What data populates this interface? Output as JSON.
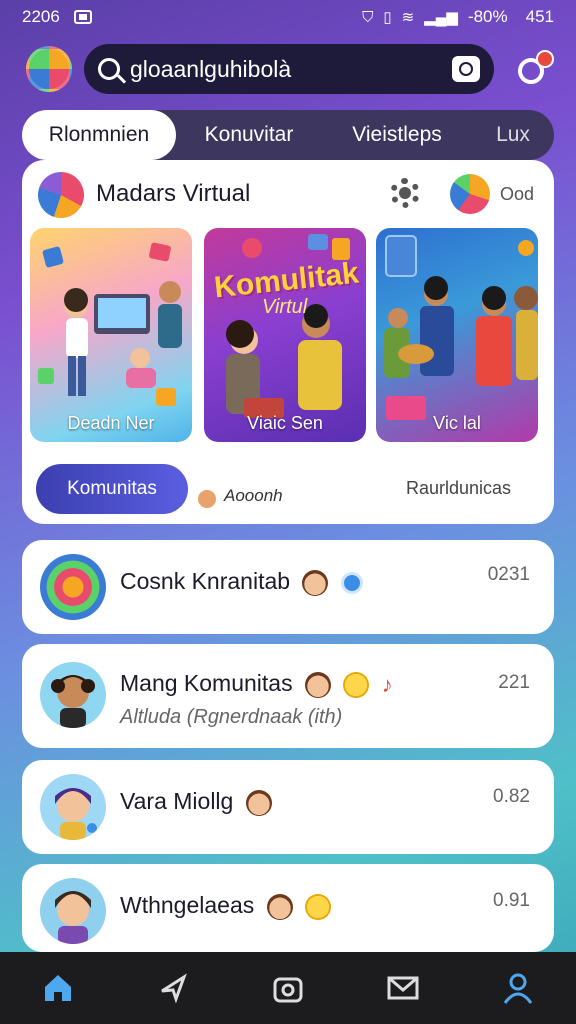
{
  "status_bar": {
    "time": "2206",
    "battery": "-80%",
    "clock": "451"
  },
  "header": {
    "search_value": "gloaanlguhibolà"
  },
  "tabs": [
    "Rlonmnien",
    "Konuvitar",
    "Vieistleps",
    "Lux"
  ],
  "featured": {
    "title": "Madars Virtual",
    "count": "Ood",
    "thumbs": [
      {
        "label": "Deadn Ner"
      },
      {
        "label": "Viaic Sen",
        "headline": "Komulitak",
        "subline": "Virtul"
      },
      {
        "label": "Vic lal"
      }
    ],
    "primary_button": "Komunitas",
    "mini_text": "Aooonh",
    "right_link": "Raurldunicas"
  },
  "chats": [
    {
      "name": "Cosnk Knranitab",
      "sub": "",
      "time": "0231"
    },
    {
      "name": "Mang Komunitas",
      "sub": "Altluda (Rgnerdnaak (ith)",
      "time": "221"
    },
    {
      "name": "Vara Miollg",
      "sub": "",
      "time": "0.82"
    },
    {
      "name": "Wthngelaeas",
      "sub": "",
      "time": "0.91"
    }
  ],
  "colors": {
    "accent": "#3b3fb0",
    "nav_active": "#4ea8f0",
    "badge": "#e8483d"
  }
}
